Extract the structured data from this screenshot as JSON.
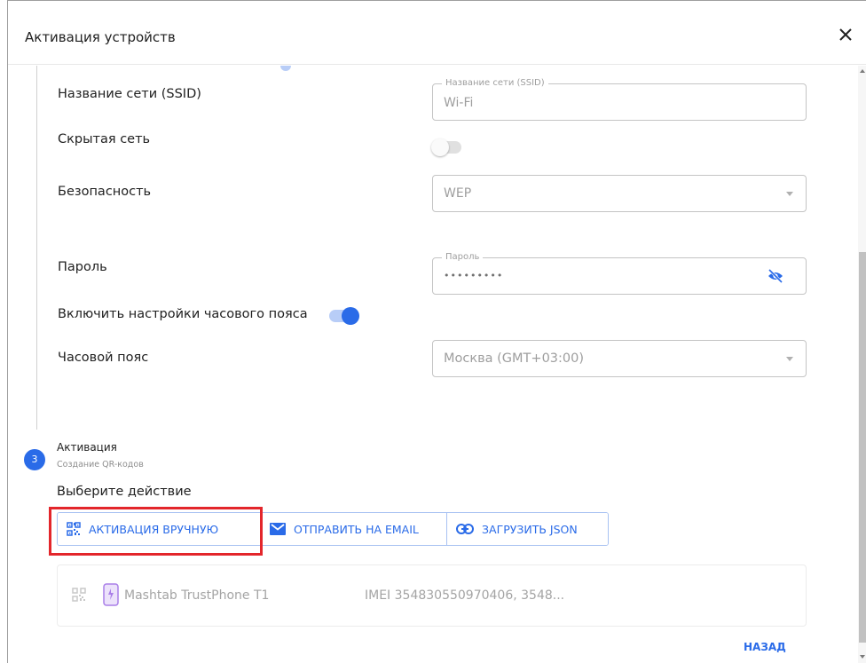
{
  "dialog": {
    "title": "Активация устройств",
    "close_icon": "close-icon"
  },
  "wifi": {
    "ssid_label": "Название сети (SSID)",
    "ssid_legend": "Название сети (SSID)",
    "ssid_value": "Wi-Fi",
    "hidden_label": "Скрытая сеть",
    "hidden_enabled": false,
    "security_label": "Безопасность",
    "security_value": "WEP",
    "password_label": "Пароль",
    "password_legend": "Пароль",
    "password_value": "•••••••••",
    "password_icon": "eye-off-icon",
    "timezone_toggle_label": "Включить настройки часового пояса",
    "timezone_enabled": true,
    "timezone_label": "Часовой пояс",
    "timezone_value": "Москва (GMT+03:00)"
  },
  "step3": {
    "number": "3",
    "title": "Активация",
    "subtitle": "Создание QR-кодов",
    "choose_label": "Выберите действие",
    "actions": [
      {
        "label": "АКТИВАЦИЯ ВРУЧНУЮ",
        "icon": "qr-code-icon",
        "highlighted": true
      },
      {
        "label": "ОТПРАВИТЬ НА EMAIL",
        "icon": "email-icon"
      },
      {
        "label": "ЗАГРУЗИТЬ JSON",
        "icon": "link-icon"
      }
    ]
  },
  "device": {
    "name": "Mashtab TrustPhone T1",
    "imei": "IMEI 354830550970406, 3548..."
  },
  "footer": {
    "back_label": "НАЗАД"
  },
  "colors": {
    "accent": "#2a6be8",
    "highlight": "#e3262b",
    "muted_text": "#9e9e9e"
  }
}
